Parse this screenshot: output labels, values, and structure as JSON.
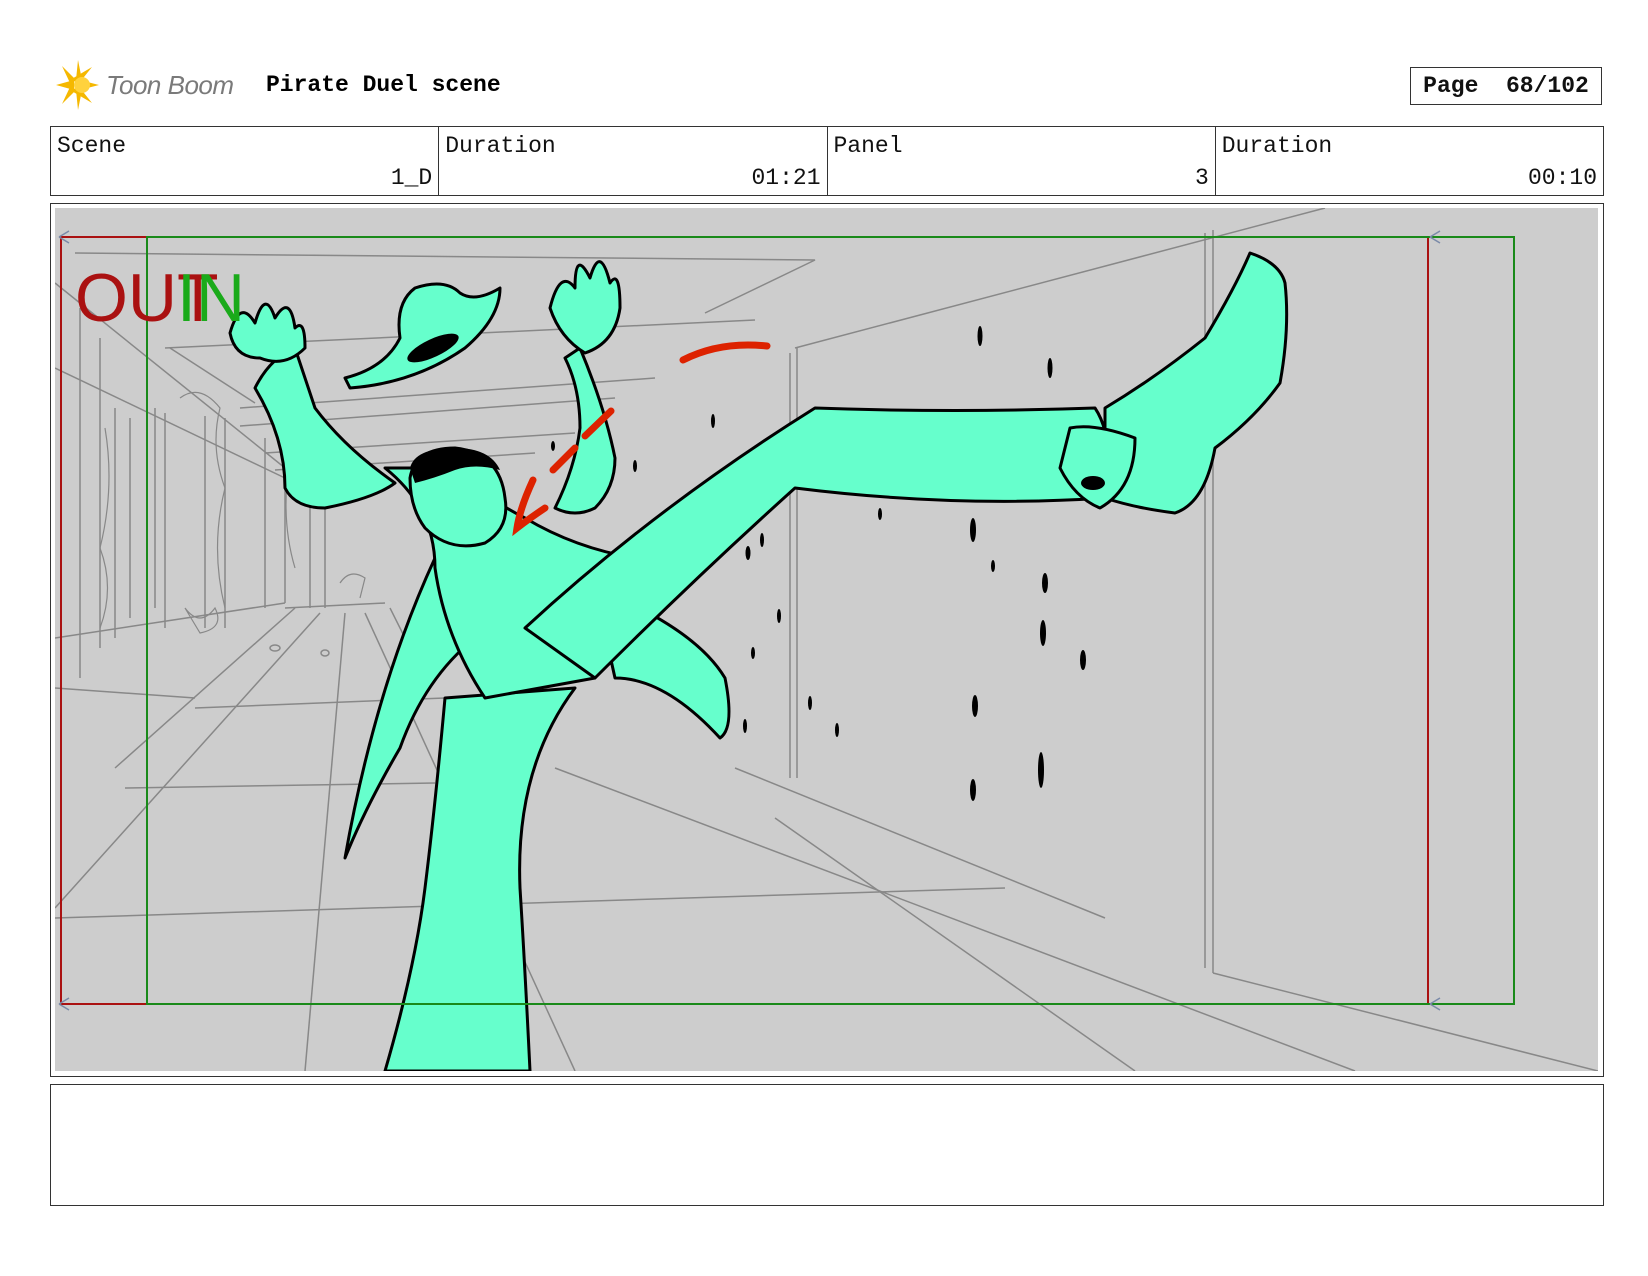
{
  "header": {
    "logo_text": "Toon Boom",
    "title": "Pirate Duel scene",
    "page_label": "Page",
    "page_value": "68/102"
  },
  "info": {
    "scene_label": "Scene",
    "scene_value": "1_D",
    "scene_duration_label": "Duration",
    "scene_duration_value": "01:21",
    "panel_label": "Panel",
    "panel_value": "3",
    "panel_duration_label": "Duration",
    "panel_duration_value": "00:10"
  },
  "frame": {
    "out_label": "OUT",
    "in_label": "IN",
    "colors": {
      "background": "#cdcdcd",
      "character": "#66ffcc",
      "out_frame": "#aa1111",
      "in_frame": "#1a8a1a",
      "impact": "#dd2200"
    }
  },
  "notes": {
    "text": ""
  }
}
